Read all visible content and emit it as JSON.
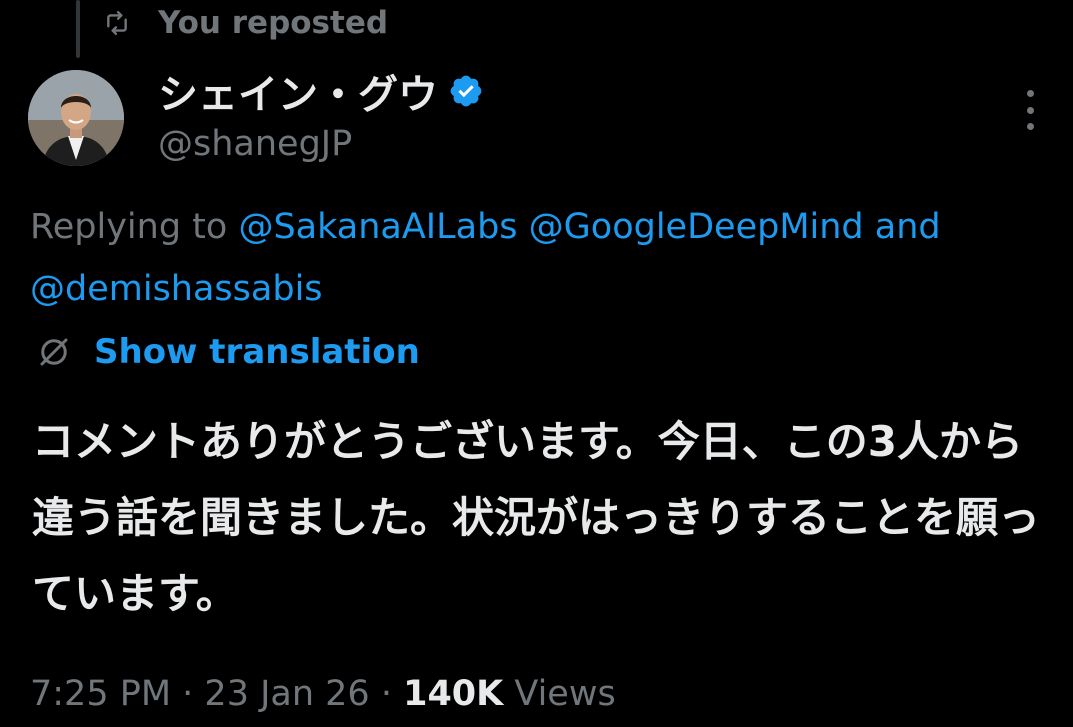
{
  "repost_header": {
    "icon": "repost-icon",
    "text": "You reposted"
  },
  "author": {
    "display_name": "シェイン・グウ",
    "handle": "@shanegJP",
    "verified": true,
    "verified_color": "#1d9bf0"
  },
  "replying": {
    "prefix": "Replying to",
    "mention_1": "@SakanaAILabs",
    "mention_2": "@GoogleDeepMind",
    "conjunction": "and",
    "mention_3": "@demishassabis"
  },
  "translation": {
    "icon": "globe-icon",
    "label": "Show translation"
  },
  "tweet": {
    "text": "コメントありがとうございます。今日、この3人から違う話を聞きました。状況がはっきりすることを願っています。"
  },
  "meta": {
    "time": "7:25 PM",
    "separator": " · ",
    "date": "23 Jan 26",
    "views_count": "140K",
    "views_label": " Views"
  },
  "colors": {
    "background": "#000000",
    "text_primary": "#e7e9ea",
    "text_secondary": "#71767b",
    "accent": "#1d9bf0"
  }
}
